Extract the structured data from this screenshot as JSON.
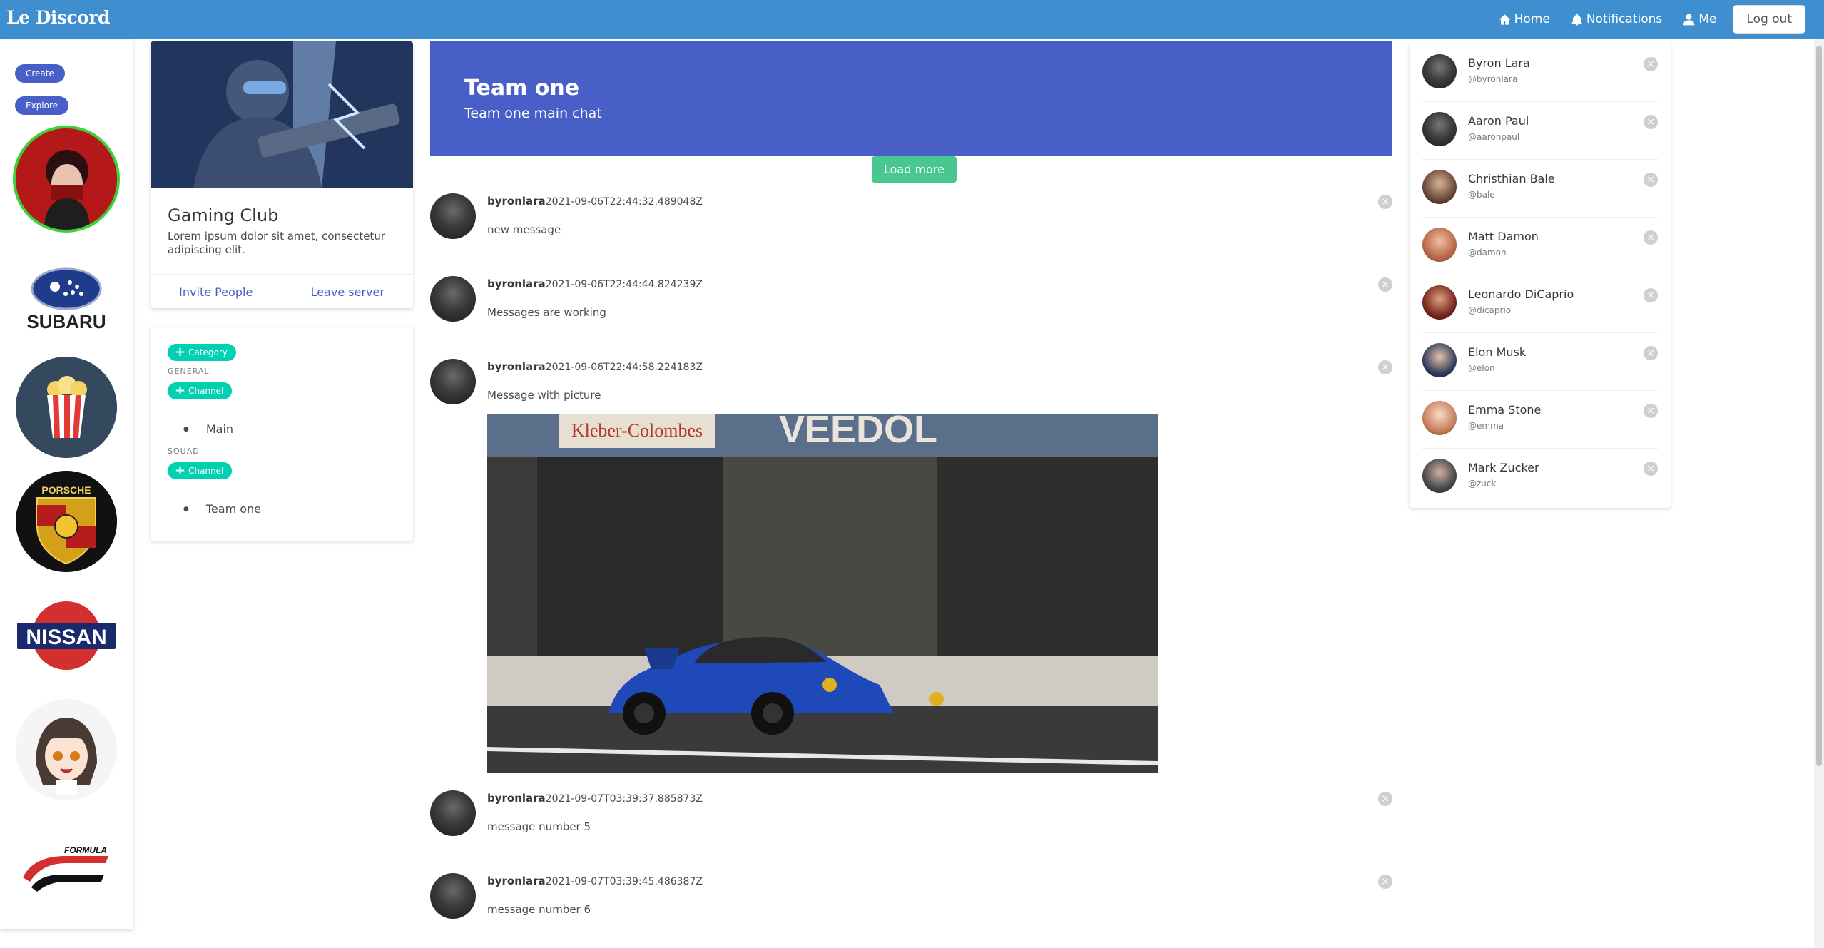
{
  "nav": {
    "brand": "Le Discord",
    "home": "Home",
    "notifications": "Notifications",
    "me": "Me",
    "logout": "Log out"
  },
  "sidebar": {
    "create": "Create",
    "explore": "Explore",
    "servers": [
      {
        "name": "anime-red-avatar",
        "text": ""
      },
      {
        "name": "subaru",
        "text": "SUBARU"
      },
      {
        "name": "popcorn",
        "text": ""
      },
      {
        "name": "porsche",
        "text": "PORSCHE"
      },
      {
        "name": "nissan",
        "text": "NISSAN"
      },
      {
        "name": "anime-girl",
        "text": ""
      },
      {
        "name": "formula-drift",
        "text": "FORMULA"
      }
    ]
  },
  "server": {
    "name": "Gaming Club",
    "description": "Lorem ipsum dolor sit amet, consectetur adipiscing elit.",
    "invite": "Invite People",
    "leave": "Leave server"
  },
  "channels": {
    "category_button": "Category",
    "channel_button": "Channel",
    "categories": [
      {
        "label": "GENERAL",
        "channels": [
          "Main"
        ]
      },
      {
        "label": "SQUAD",
        "channels": [
          "Team one"
        ]
      }
    ]
  },
  "chat": {
    "title": "Team one",
    "subtitle": "Team one main chat",
    "load_more": "Load more",
    "messages": [
      {
        "user": "byronlara",
        "time": "2021-09-06T22:44:32.489048Z",
        "text": "new message"
      },
      {
        "user": "byronlara",
        "time": "2021-09-06T22:44:44.824239Z",
        "text": "Messages are working"
      },
      {
        "user": "byronlara",
        "time": "2021-09-06T22:44:58.224183Z",
        "text": "Message with picture"
      },
      {
        "user": "byronlara",
        "time": "2021-09-07T03:39:37.885873Z",
        "text": "message number 5"
      },
      {
        "user": "byronlara",
        "time": "2021-09-07T03:39:45.486387Z",
        "text": "message number 6"
      }
    ],
    "image_sign_left": "Kleber-Colombes",
    "image_sign_right": "VEEDOL"
  },
  "members": [
    {
      "name": "Byron Lara",
      "handle": "@byronlara",
      "color": "#3a3a3a"
    },
    {
      "name": "Aaron Paul",
      "handle": "@aaronpaul",
      "color": "#3a3a3a"
    },
    {
      "name": "Christhian Bale",
      "handle": "@bale",
      "color": "#6b4a3a"
    },
    {
      "name": "Matt Damon",
      "handle": "@damon",
      "color": "#b86a4a"
    },
    {
      "name": "Leonardo DiCaprio",
      "handle": "@dicaprio",
      "color": "#7a2a20"
    },
    {
      "name": "Elon Musk",
      "handle": "@elon",
      "color": "#2a3a5a"
    },
    {
      "name": "Emma Stone",
      "handle": "@emma",
      "color": "#c88060"
    },
    {
      "name": "Mark Zucker",
      "handle": "@zuck",
      "color": "#4a4a4a"
    }
  ],
  "colors": {
    "navbar": "#3e8ed0",
    "primary": "#485fc7",
    "success": "#48c78e",
    "turquoise": "#00d1b2"
  }
}
